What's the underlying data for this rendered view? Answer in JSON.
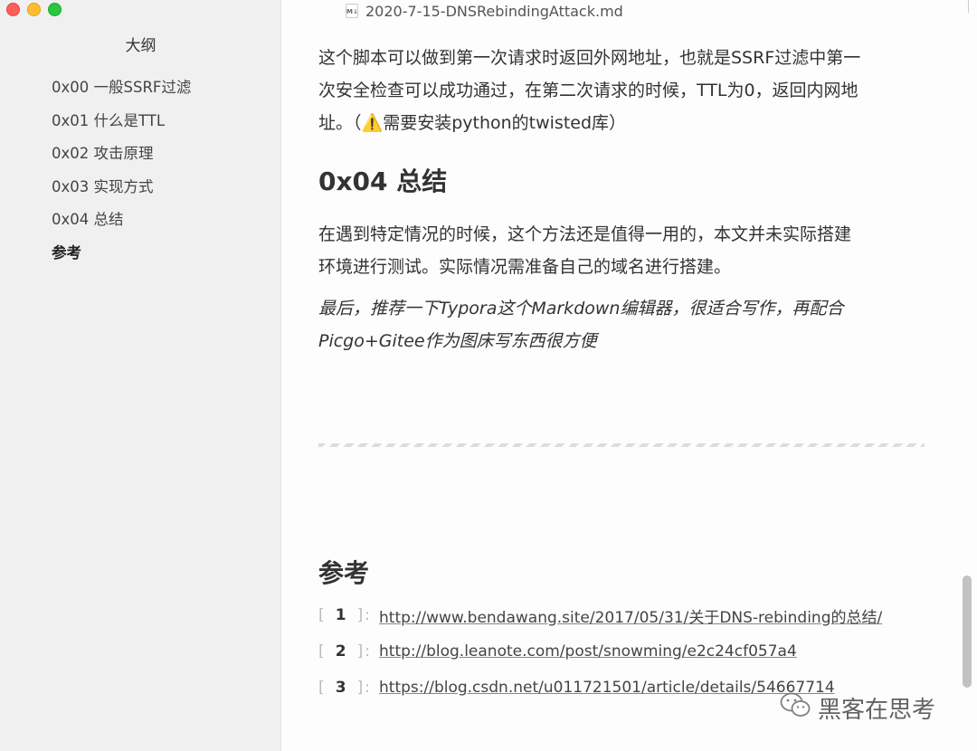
{
  "window": {
    "file_title": "2020-7-15-DNSRebindingAttack.md",
    "file_icon_label": "M↓"
  },
  "sidebar": {
    "title": "大纲",
    "items": [
      {
        "label": "0x00 一般SSRF过滤"
      },
      {
        "label": "0x01 什么是TTL"
      },
      {
        "label": "0x02 攻击原理"
      },
      {
        "label": "0x03 实现方式"
      },
      {
        "label": "0x04 总结"
      },
      {
        "label": "参考",
        "active": true
      }
    ]
  },
  "main": {
    "intro_line1": "这个脚本可以做到第一次请求时返回外网地址，也就是SSRF过滤中第一",
    "intro_line2": "次安全检查可以成功通过，在第二次请求的时候，TTL为0，返回内网地",
    "intro_line3_prefix": "址。（",
    "warning_icon": "⚠️",
    "intro_line3_suffix": "需要安装python的twisted库）",
    "summary_heading": "0x04 总结",
    "summary_line1": "在遇到特定情况的时候，这个方法还是值得一用的，本文并未实际搭建",
    "summary_line2": "环境进行测试。实际情况需准备自己的域名进行搭建。",
    "italic_line1": "最后，推荐一下Typora这个Markdown编辑器，很适合写作，再配合",
    "italic_line2": "Picgo+Gitee作为图床写东西很方便",
    "references_heading": "参考",
    "references": [
      {
        "num": "1",
        "url": "http://www.bendawang.site/2017/05/31/关于DNS-rebinding的总结/"
      },
      {
        "num": "2",
        "url": "http://blog.leanote.com/post/snowming/e2c24cf057a4"
      },
      {
        "num": "3",
        "url": "https://blog.csdn.net/u011721501/article/details/54667714"
      }
    ]
  },
  "watermark": {
    "text": "黑客在思考"
  },
  "colors": {
    "sidebar_bg": "#f0f0f0",
    "content_bg": "#fdfdfd",
    "close": "#fe5f57",
    "minimize": "#febc2e",
    "maximize": "#28c840"
  }
}
